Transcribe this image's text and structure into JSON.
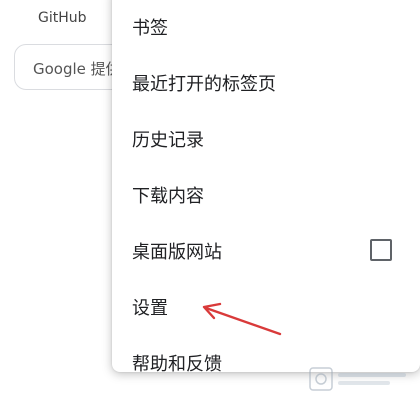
{
  "background": {
    "link_label": "GitHub",
    "search_text": "Google 提供的"
  },
  "menu": {
    "items": [
      {
        "label": "书签"
      },
      {
        "label": "最近打开的标签页"
      },
      {
        "label": "历史记录"
      },
      {
        "label": "下载内容"
      },
      {
        "label": "桌面版网站",
        "checkbox_checked": false
      },
      {
        "label": "设置"
      },
      {
        "label": "帮助和反馈"
      }
    ]
  },
  "annotation": {
    "arrow_color": "#d93a3a",
    "target": "设置"
  },
  "colors": {
    "text_primary": "#202124",
    "checkbox_border": "#5f6368"
  }
}
